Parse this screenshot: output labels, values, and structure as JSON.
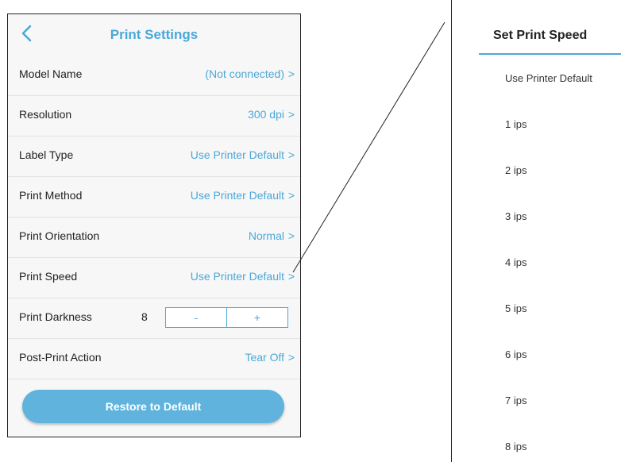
{
  "settings": {
    "title": "Print Settings",
    "rows": [
      {
        "label": "Model Name",
        "value": "(Not connected)"
      },
      {
        "label": "Resolution",
        "value": "300 dpi"
      },
      {
        "label": "Label Type",
        "value": "Use Printer Default"
      },
      {
        "label": "Print Method",
        "value": "Use Printer Default"
      },
      {
        "label": "Print Orientation",
        "value": "Normal"
      },
      {
        "label": "Print Speed",
        "value": "Use Printer Default"
      }
    ],
    "darkness": {
      "label": "Print Darkness",
      "value": "8",
      "minus": "-",
      "plus": "+"
    },
    "post_print": {
      "label": "Post-Print Action",
      "value": "Tear Off"
    },
    "restore_label": "Restore to Default",
    "chevron": ">"
  },
  "speed_dialog": {
    "title": "Set Print Speed",
    "options": [
      "Use Printer Default",
      "1 ips",
      "2 ips",
      "3 ips",
      "4 ips",
      "5 ips",
      "6 ips",
      "7 ips",
      "8 ips"
    ]
  },
  "colors": {
    "accent": "#4aa8d8",
    "button": "#5fb3dc"
  },
  "icons": {
    "back": "chevron-left-icon",
    "row_arrow": "chevron-right-icon"
  }
}
